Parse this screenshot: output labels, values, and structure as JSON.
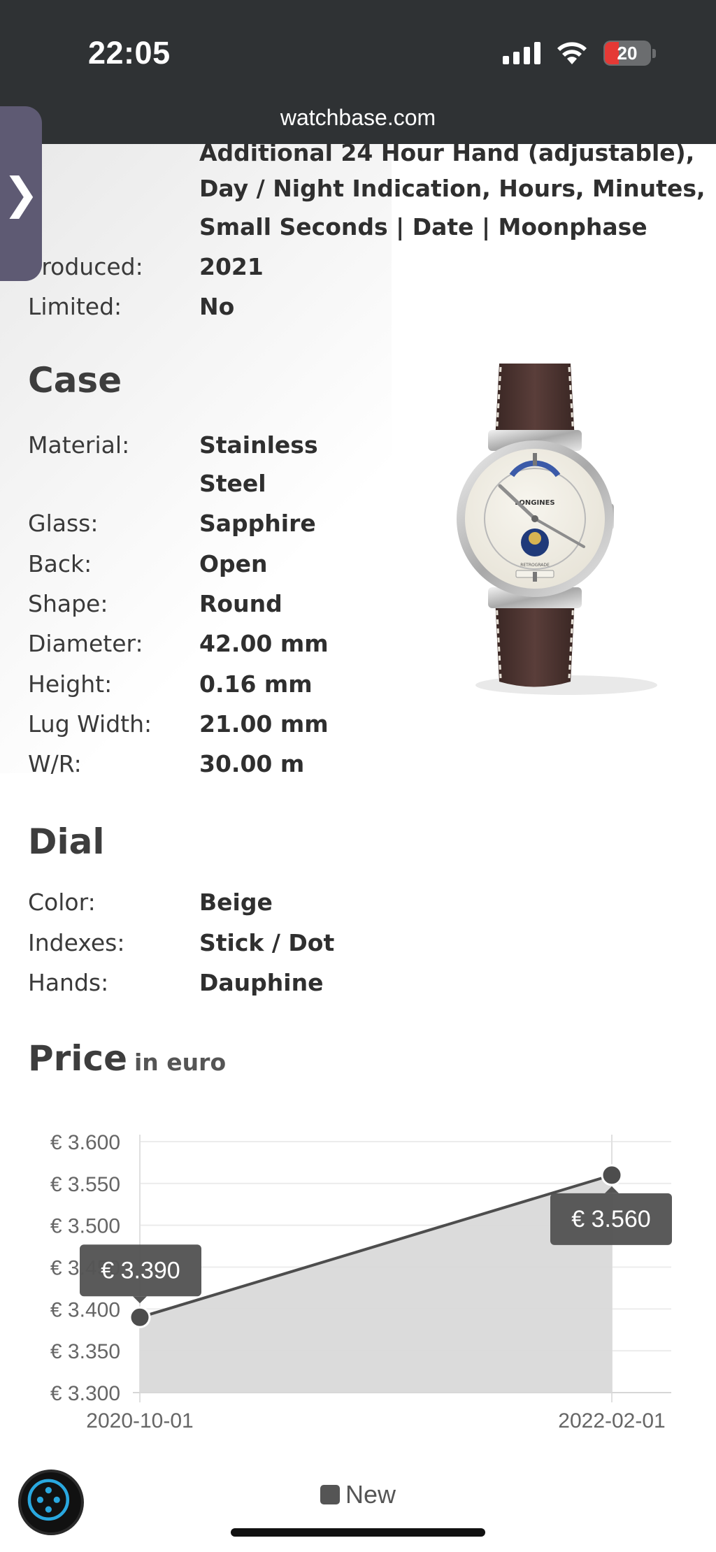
{
  "status_bar": {
    "time": "22:05",
    "battery": "20"
  },
  "browser": {
    "url": "watchbase.com"
  },
  "functions_continued": {
    "lines": [
      "Additional 24 Hour Hand (adjustable),",
      "Day / Night Indication, Hours, Minutes,",
      "Small Seconds | Date | Moonphase"
    ]
  },
  "overview": {
    "produced_label": "Produced:",
    "produced_value": "2021",
    "limited_label": "Limited:",
    "limited_value": "No"
  },
  "case": {
    "title": "Case",
    "rows": [
      {
        "label": "Material:",
        "value": "Stainless"
      },
      {
        "label": "",
        "value": "Steel"
      },
      {
        "label": "Glass:",
        "value": "Sapphire"
      },
      {
        "label": "Back:",
        "value": "Open"
      },
      {
        "label": "Shape:",
        "value": "Round"
      },
      {
        "label": "Diameter:",
        "value": "42.00 mm"
      },
      {
        "label": "Height:",
        "value": "0.16 mm"
      },
      {
        "label": "Lug Width:",
        "value": "21.00 mm"
      },
      {
        "label": "W/R:",
        "value": "30.00 m"
      }
    ]
  },
  "dial": {
    "title": "Dial",
    "rows": [
      {
        "label": "Color:",
        "value": "Beige"
      },
      {
        "label": "Indexes:",
        "value": "Stick / Dot"
      },
      {
        "label": "Hands:",
        "value": "Dauphine"
      }
    ]
  },
  "price": {
    "title": "Price",
    "subtitle": "in euro"
  },
  "watch_image": {
    "brand": "LONGINES",
    "dial_text": "RETROGRADE"
  },
  "chart_data": {
    "type": "area",
    "x": [
      "2020-10-01",
      "2022-02-01"
    ],
    "series": [
      {
        "name": "New",
        "values": [
          3390,
          3560
        ],
        "labels": [
          "€ 3.390",
          "€ 3.560"
        ]
      }
    ],
    "y_ticks": [
      3600,
      3550,
      3500,
      3450,
      3400,
      3350,
      3300
    ],
    "y_tick_labels": [
      "€ 3.600",
      "€ 3.550",
      "€ 3.500",
      "€ 3.450",
      "€ 3.400",
      "€ 3.350",
      "€ 3.300"
    ],
    "ylim": [
      3300,
      3600
    ],
    "grid": true,
    "legend_position": "bottom",
    "colors": {
      "line": "#4d4d4d",
      "fill": "#d9d9d9",
      "tooltip": "#555555"
    }
  }
}
